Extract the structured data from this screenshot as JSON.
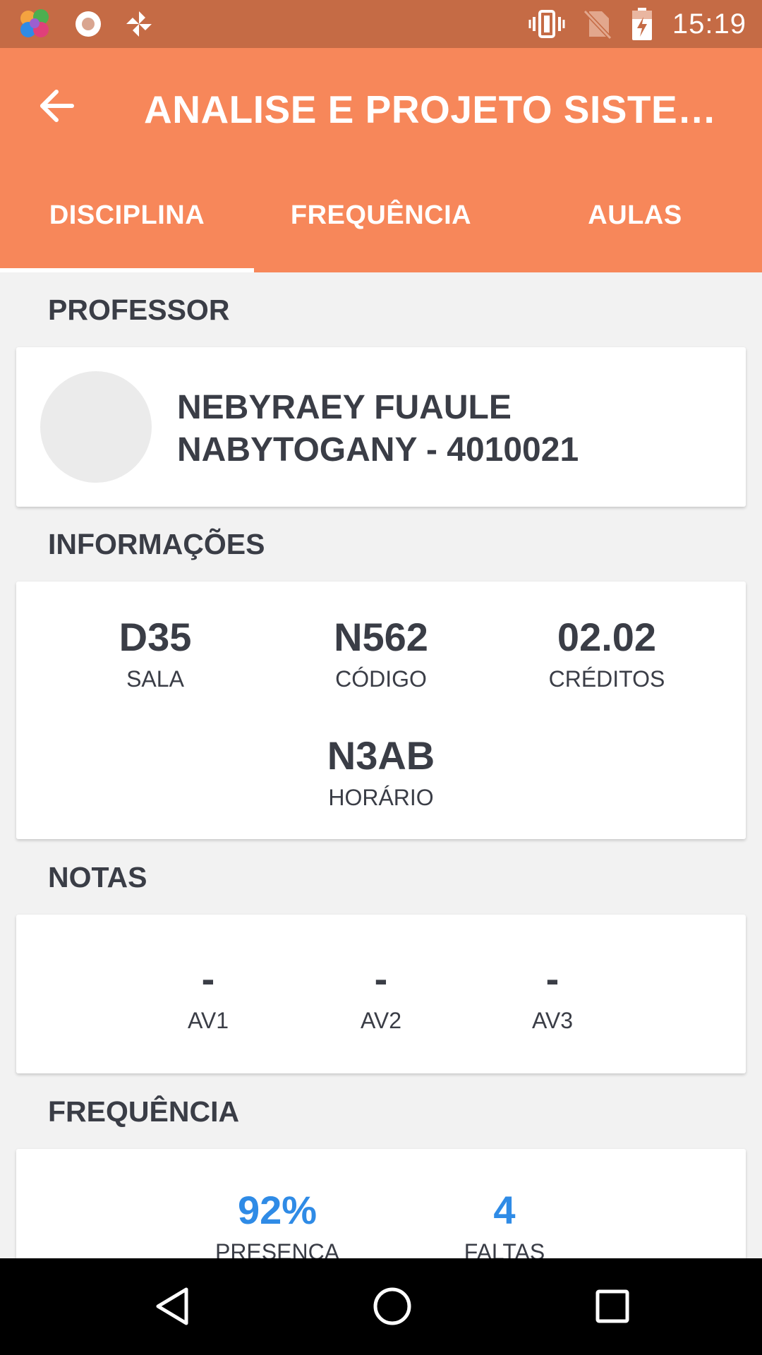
{
  "status_bar": {
    "time": "15:19",
    "icons": [
      "brain-app-icon",
      "record-icon",
      "pinwheel-icon",
      "vibrate-icon",
      "no-sim-icon",
      "battery-charging-icon"
    ]
  },
  "app_bar": {
    "title": "ANALISE E PROJETO SISTEMA…",
    "back_icon": "arrow-back-icon",
    "tabs": [
      {
        "label": "DISCIPLINA",
        "active": true
      },
      {
        "label": "FREQUÊNCIA",
        "active": false
      },
      {
        "label": "AULAS",
        "active": false
      }
    ]
  },
  "professor": {
    "section_title": "PROFESSOR",
    "name_line1": "NEBYRAEY FUAULE",
    "name_line2": "NABYTOGANY - 4010021"
  },
  "informacoes": {
    "section_title": "INFORMAÇÕES",
    "sala": {
      "value": "D35",
      "label": "SALA"
    },
    "codigo": {
      "value": "N562",
      "label": "CÓDIGO"
    },
    "creditos": {
      "value": "02.02",
      "label": "CRÉDITOS"
    },
    "horario": {
      "value": "N3AB",
      "label": "HORÁRIO"
    }
  },
  "notas": {
    "section_title": "NOTAS",
    "av1": {
      "value": "-",
      "label": "AV1"
    },
    "av2": {
      "value": "-",
      "label": "AV2"
    },
    "av3": {
      "value": "-",
      "label": "AV3"
    }
  },
  "frequencia": {
    "section_title": "FREQUÊNCIA",
    "presenca": {
      "value": "92%",
      "label": "PRESENÇA"
    },
    "faltas": {
      "value": "4",
      "label": "FALTAS"
    }
  },
  "colors": {
    "status_bar": "#c56b45",
    "app_bar": "#f7875a",
    "accent_blue": "#2f8be6",
    "text_dark": "#3a3d46",
    "background": "#f2f2f2"
  }
}
